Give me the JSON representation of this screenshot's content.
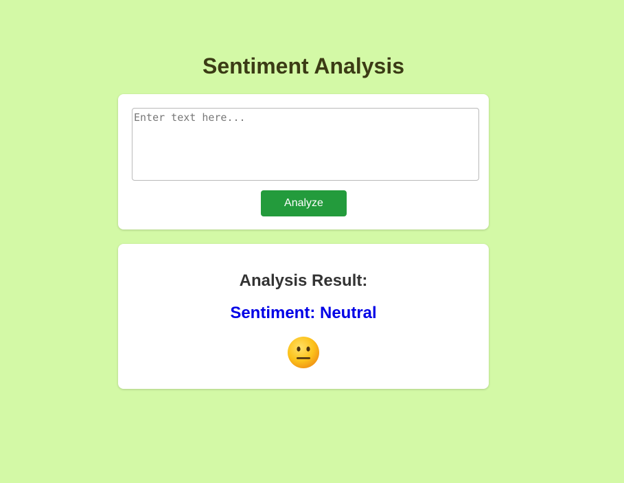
{
  "page": {
    "title": "Sentiment Analysis"
  },
  "input_card": {
    "textarea_placeholder": "Enter text here...",
    "textarea_value": "",
    "analyze_label": "Analyze"
  },
  "result_card": {
    "heading": "Analysis Result:",
    "sentiment_text": "Sentiment: Neutral",
    "emoji_icon": "neutral-face-icon"
  },
  "colors": {
    "background": "#d3f9a6",
    "title": "#3b3b15",
    "button": "#239b3c",
    "sentiment": "#0000e6"
  }
}
